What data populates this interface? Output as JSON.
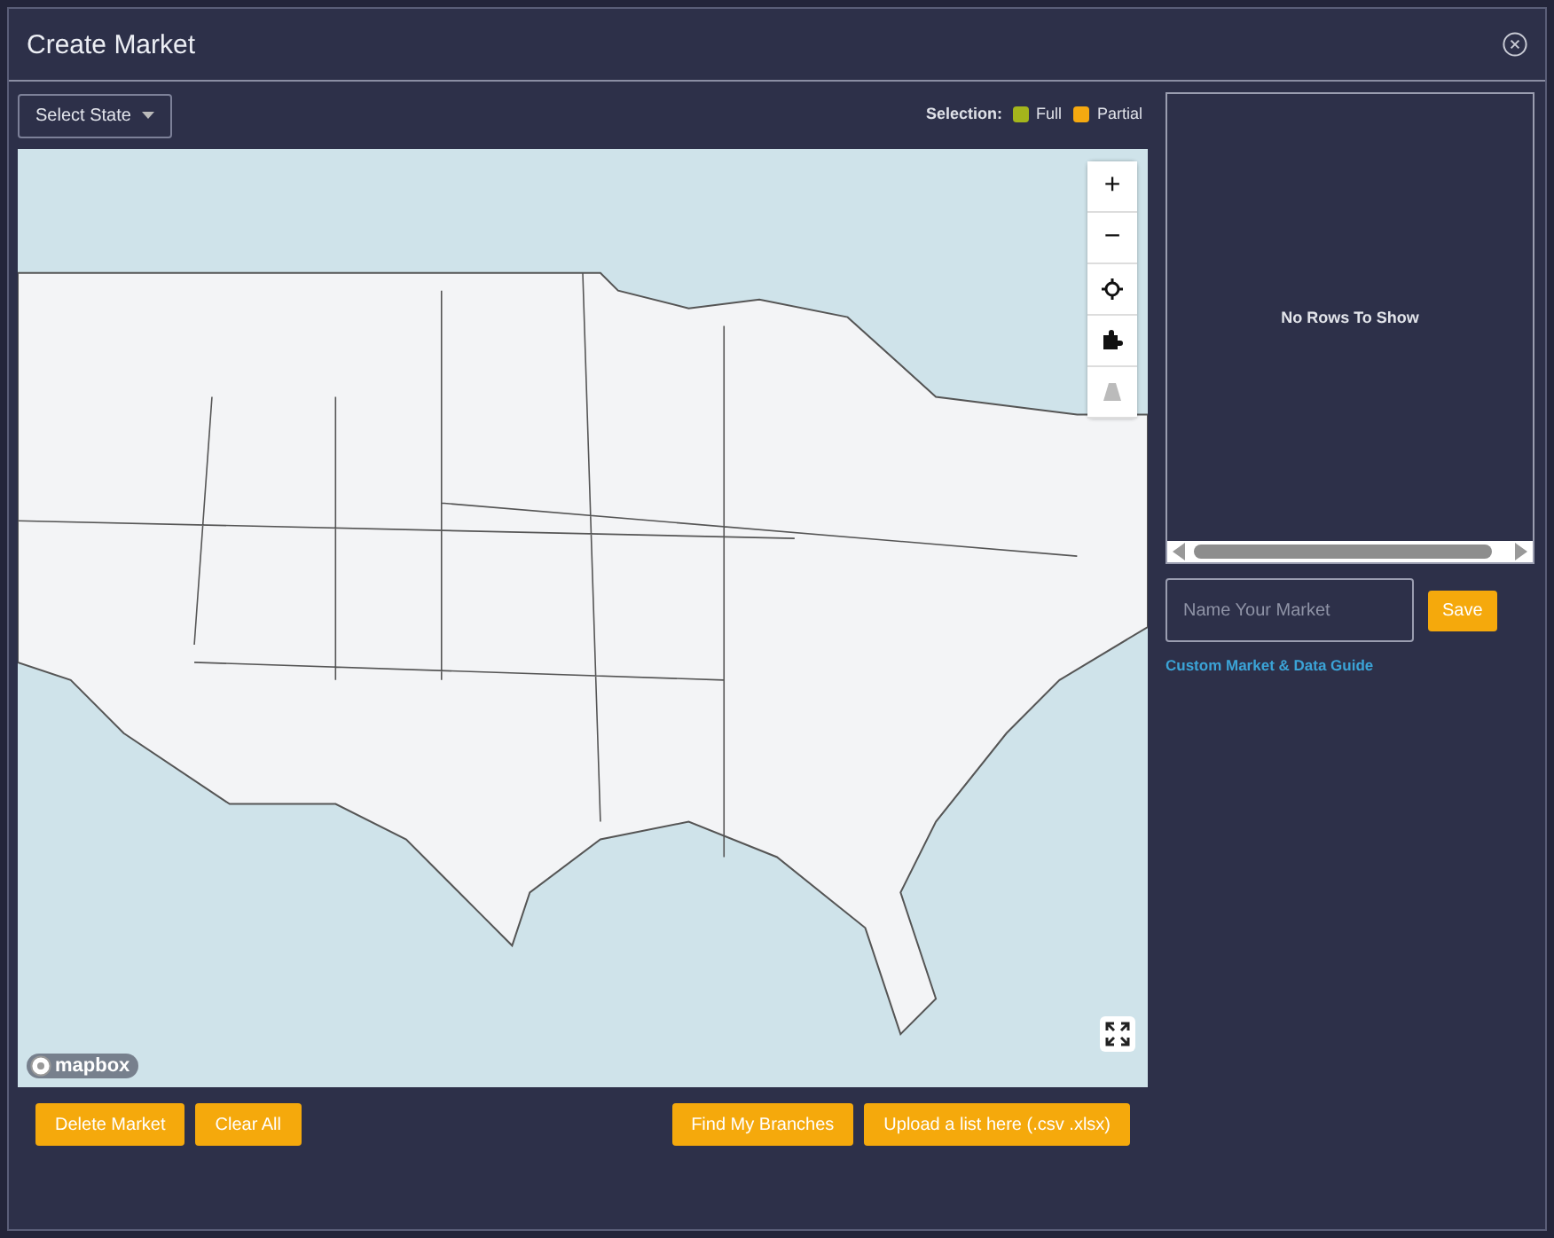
{
  "window": {
    "title": "Create Market"
  },
  "state_select": {
    "label": "Select State"
  },
  "legend": {
    "title": "Selection:",
    "items": [
      {
        "label": "Full",
        "color": "#a4b51c"
      },
      {
        "label": "Partial",
        "color": "#f5a910"
      }
    ]
  },
  "map": {
    "controls": [
      {
        "kind": "zoom-in",
        "label": "+",
        "disabled": false
      },
      {
        "kind": "zoom-out",
        "label": "−",
        "disabled": false
      },
      {
        "kind": "locate",
        "disabled": false
      },
      {
        "kind": "puzzle",
        "disabled": false
      },
      {
        "kind": "road",
        "disabled": true
      }
    ],
    "attribution": "mapbox"
  },
  "grid": {
    "empty_message": "No Rows To Show"
  },
  "market_name": {
    "placeholder": "Name Your Market"
  },
  "save_button": "Save",
  "guide_link": "Custom Market & Data Guide",
  "actions_left": [
    "Delete Market",
    "Clear All"
  ],
  "actions_right": [
    "Find My Branches",
    "Upload a list here (.csv .xlsx)"
  ]
}
